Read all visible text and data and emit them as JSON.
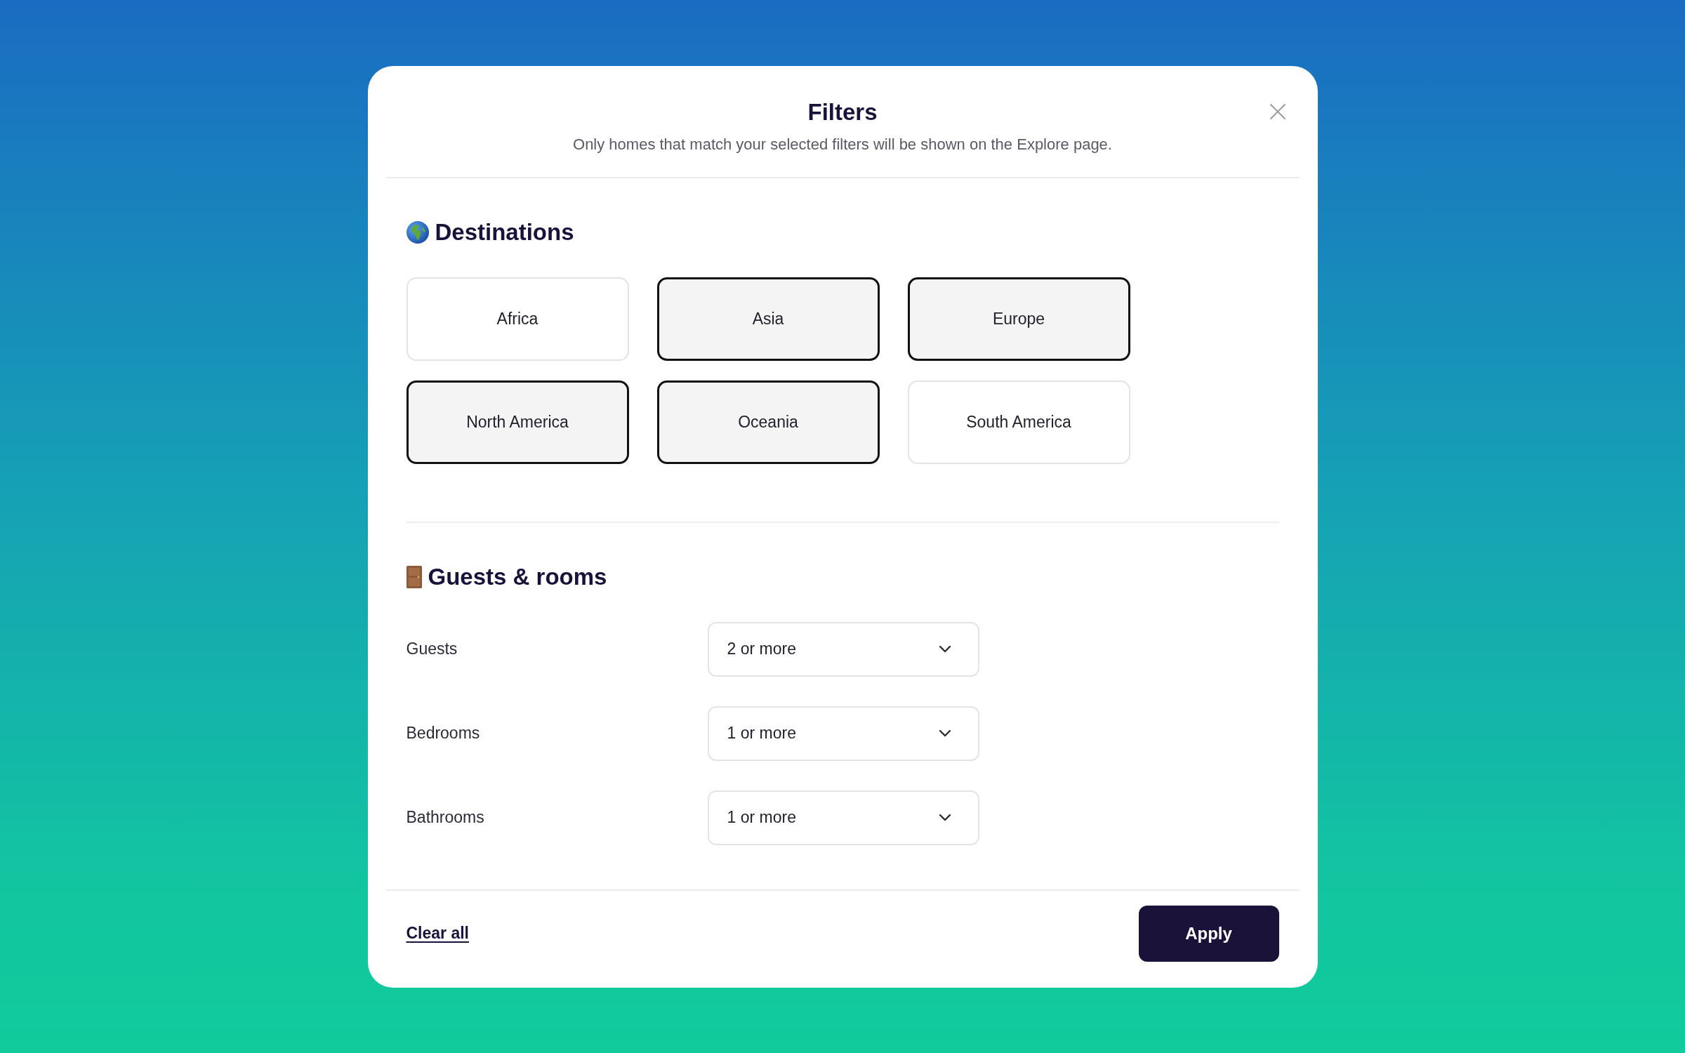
{
  "dialog": {
    "title": "Filters",
    "subtitle": "Only homes that match your selected filters will be shown on the Explore page."
  },
  "sections": [
    {
      "kind": "options",
      "title": "Destinations",
      "options": [
        {
          "label": "Africa",
          "selected": false
        },
        {
          "label": "Asia",
          "selected": true
        },
        {
          "label": "Europe",
          "selected": true
        },
        {
          "label": "North America",
          "selected": true
        },
        {
          "label": "Oceania",
          "selected": true
        },
        {
          "label": "South America",
          "selected": false
        }
      ]
    },
    {
      "kind": "selects",
      "title": "Guests & rooms",
      "fields": [
        {
          "label": "Guests",
          "value": "2 or more"
        },
        {
          "label": "Bedrooms",
          "value": "1 or more"
        },
        {
          "label": "Bathrooms",
          "value": "1 or more"
        }
      ]
    }
  ],
  "footer": {
    "clear_link": "Clear all",
    "apply_button": "Apply"
  }
}
